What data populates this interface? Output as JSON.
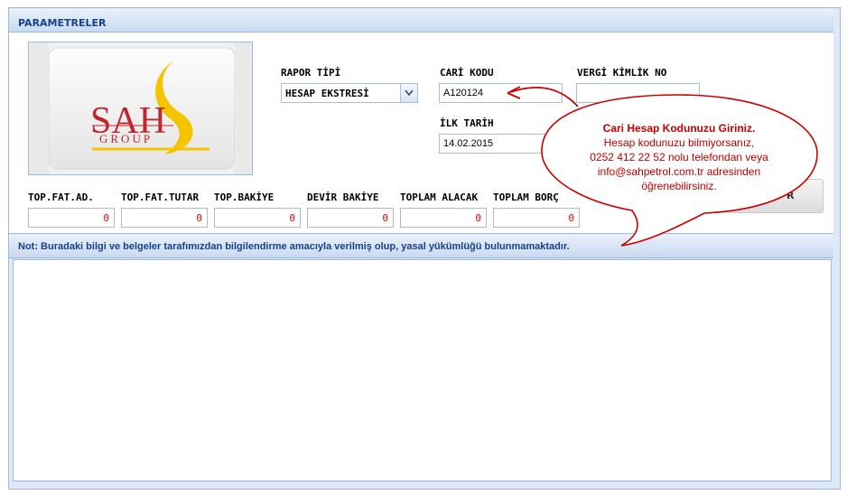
{
  "panel": {
    "title": "PARAMETRELER"
  },
  "logo": {
    "brand_text": "SAH",
    "group_text": "GROUP"
  },
  "form": {
    "rapor_tipi": {
      "label": "RAPOR TİPİ",
      "value": "HESAP EKSTRESİ"
    },
    "cari_kodu": {
      "label": "CARİ KODU",
      "value": "A120124"
    },
    "vergi_kimlik": {
      "label": "VERGİ KİMLİK NO",
      "value": ""
    },
    "ilk_tarih": {
      "label": "İLK TARİH",
      "value": "14.02.2015"
    }
  },
  "summary": [
    {
      "label": "TOP.FAT.AD.",
      "value": "0"
    },
    {
      "label": "TOP.FAT.TUTAR",
      "value": "0"
    },
    {
      "label": "TOP.BAKİYE",
      "value": "0"
    },
    {
      "label": "DEVİR BAKİYE",
      "value": "0"
    },
    {
      "label": "TOPLAM ALACAK",
      "value": "0"
    },
    {
      "label": "TOPLAM BORÇ",
      "value": "0"
    }
  ],
  "button": {
    "label": "R"
  },
  "note": {
    "text": "Not: Buradaki bilgi ve belgeler tarafımızdan bilgilendirme amacıyla verilmiş olup, yasal yükümlüğü bulunmamaktadır."
  },
  "callout": {
    "title": "Cari Hesap Kodunuzu Giriniz.",
    "lines": [
      "Hesap kodunuzu bilmiyorsanız,",
      "0252 412 22 52 nolu telefondan veya",
      "info@sahpetrol.com.tr adresinden",
      "öğrenebilirsiniz."
    ]
  },
  "colors": {
    "header_text": "#15428b",
    "callout_red": "#cc0000",
    "value_red": "#e00000",
    "border_blue": "#99bbe8"
  }
}
